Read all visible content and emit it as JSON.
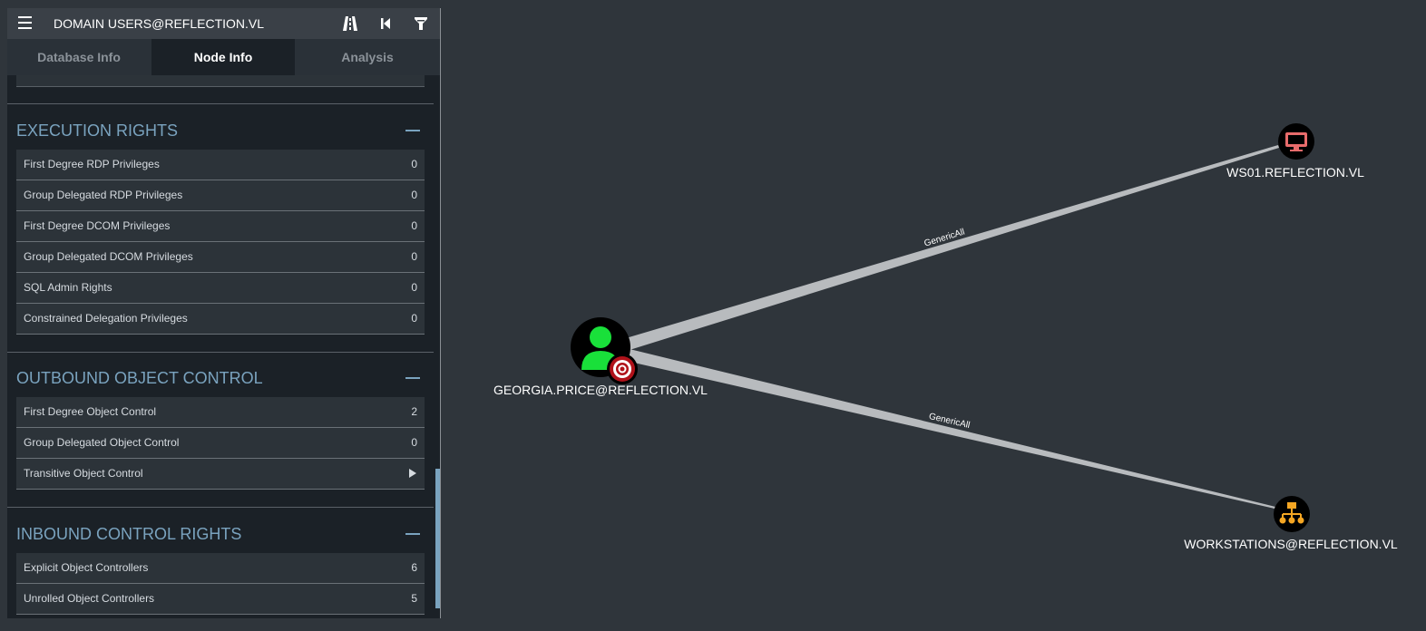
{
  "header": {
    "title": "DOMAIN USERS@REFLECTION.VL",
    "icons": [
      "menu-icon",
      "pathfinding-icon",
      "back-icon",
      "filter-icon"
    ]
  },
  "tabs": [
    {
      "label": "Database Info",
      "active": false
    },
    {
      "label": "Node Info",
      "active": true
    },
    {
      "label": "Analysis",
      "active": false
    }
  ],
  "sections": {
    "execution": {
      "title": "EXECUTION RIGHTS",
      "rows": [
        {
          "label": "First Degree RDP Privileges",
          "value": "0"
        },
        {
          "label": "Group Delegated RDP Privileges",
          "value": "0"
        },
        {
          "label": "First Degree DCOM Privileges",
          "value": "0"
        },
        {
          "label": "Group Delegated DCOM Privileges",
          "value": "0"
        },
        {
          "label": "SQL Admin Rights",
          "value": "0"
        },
        {
          "label": "Constrained Delegation Privileges",
          "value": "0"
        }
      ]
    },
    "outbound": {
      "title": "OUTBOUND OBJECT CONTROL",
      "rows": [
        {
          "label": "First Degree Object Control",
          "value": "2"
        },
        {
          "label": "Group Delegated Object Control",
          "value": "0"
        },
        {
          "label": "Transitive Object Control",
          "value": ""
        }
      ]
    },
    "inbound": {
      "title": "INBOUND CONTROL RIGHTS",
      "rows": [
        {
          "label": "Explicit Object Controllers",
          "value": "6"
        },
        {
          "label": "Unrolled Object Controllers",
          "value": "5"
        }
      ]
    }
  },
  "graph": {
    "nodes": {
      "user": {
        "label": "GEORGIA.PRICE@REFLECTION.VL",
        "icon": "user-icon",
        "badge": "target-icon",
        "color": "#19e03a"
      },
      "computer": {
        "label": "WS01.REFLECTION.VL",
        "icon": "computer-icon",
        "color": "#e86b6b"
      },
      "ou": {
        "label": "WORKSTATIONS@REFLECTION.VL",
        "icon": "ou-icon",
        "color": "#f5a623"
      }
    },
    "edges": {
      "to_computer": {
        "label": "GenericAll"
      },
      "to_ou": {
        "label": "GenericAll"
      }
    }
  },
  "colors": {
    "background": "#2f353b",
    "panel": "#1b2127",
    "accent": "#7aa3bf",
    "edge": "#b8bbbe"
  }
}
